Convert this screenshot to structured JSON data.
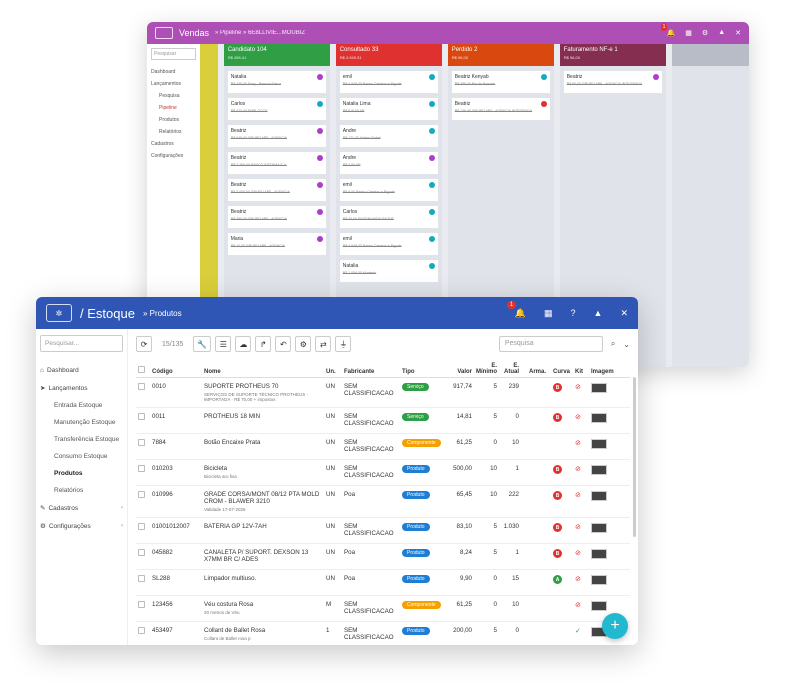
{
  "back": {
    "title": "Vendas",
    "crumb": "» Pipeline » 6E8LLIVIE...MOUBIZ",
    "search_placeholder": "Pesquisar",
    "menu": [
      {
        "label": "Dashboard",
        "cls": ""
      },
      {
        "label": "Lançamentos",
        "cls": ""
      },
      {
        "label": "Pesquisa",
        "cls": "sub"
      },
      {
        "label": "Pipeline",
        "cls": "sub act"
      },
      {
        "label": "Produtos",
        "cls": "sub"
      },
      {
        "label": "Relatórios",
        "cls": "sub"
      },
      {
        "label": "Cadastros",
        "cls": ""
      },
      {
        "label": "Configurações",
        "cls": ""
      }
    ],
    "columns": [
      {
        "name": "Candidato",
        "badge": "104",
        "sub": "R$ 498.41",
        "color": "#2f9e44",
        "cards": [
          {
            "t": "Natalia",
            "d": "R$ 235,00 Sony - Pessoa Física",
            "c": "#ae3ec9"
          },
          {
            "t": "Carlos",
            "d": "R$ 420,00 EMBLOCCS",
            "c": "#15aabf"
          },
          {
            "t": "Beatriz",
            "d": "R$ 549,00 GRUPO APF - AGENCIA",
            "c": "#ae3ec9"
          },
          {
            "t": "Beatriz",
            "d": "R$ 2.360,00 BANCO SISTEMA S.A.",
            "c": "#ae3ec9"
          },
          {
            "t": "Beatriz",
            "d": "R$ 3.000,00 GRUPO APF - AGENCIA",
            "c": "#ae3ec9"
          },
          {
            "t": "Beatriz",
            "d": "R$ 390,00 GRUPO APF - AGENCIA",
            "c": "#ae3ec9"
          },
          {
            "t": "Maria",
            "d": "R$ 10,00 GRUPO APF - AGENCIA",
            "c": "#ae3ec9"
          }
        ]
      },
      {
        "name": "Consultado",
        "badge": "33",
        "sub": "R$ 4.949.31",
        "color": "#e03131",
        "cards": [
          {
            "t": "emil",
            "d": "R$ 4.949,00 Banho Cabelos e Bigode",
            "c": "#15aabf"
          },
          {
            "t": "Natalia Lima",
            "d": "R$ 518,00 AP",
            "c": "#15aabf"
          },
          {
            "t": "Andre",
            "d": "R$ 171,00 Aldeia Global",
            "c": "#15aabf"
          },
          {
            "t": "Andre",
            "d": "R$ 3,00 AP",
            "c": "#ae3ec9"
          },
          {
            "t": "emil",
            "d": "R$ 9,00 Banho Cabelos e Bigode",
            "c": "#15aabf"
          },
          {
            "t": "Carlos",
            "d": "R$ 40,00 ENGENHARIA SAÚDE",
            "c": "#15aabf"
          },
          {
            "t": "emil",
            "d": "R$ 4.949,00 Banho Cabelos e Bigode",
            "c": "#15aabf"
          },
          {
            "t": "Natalia",
            "d": "R$ 1.006,00 Modesto",
            "c": "#15aabf"
          }
        ]
      },
      {
        "name": "Perdido",
        "badge": "2",
        "sub": "R$ 96,00",
        "color": "#d9480f",
        "cards": [
          {
            "t": "Beatriz Kenyab",
            "d": "R$ 386,00 Bia da Horroes",
            "c": "#15aabf"
          },
          {
            "t": "Beatriz",
            "d": "R$ 136,00 GRUPO APF - AGENCIA INTEGRADA",
            "c": "#e03131"
          }
        ]
      },
      {
        "name": "Faturamento NF-e",
        "badge": "1",
        "sub": "R$ 96,00",
        "color": "#862e50",
        "cards": [
          {
            "t": "Beatriz",
            "d": "R$ 80,00 GRUPO APF - AGENCIA INTEGRADA",
            "c": "#ae3ec9"
          }
        ]
      }
    ]
  },
  "front": {
    "title": "Estoque",
    "crumb": "» Produtos",
    "notif_count": "1",
    "search_placeholder": "Pesquisar...",
    "count": "15/135",
    "table_search_placeholder": "Pesquisa",
    "menu": [
      {
        "icon": "⌂",
        "label": "Dashboard",
        "cls": "",
        "chev": ""
      },
      {
        "icon": "➤",
        "label": "Lançamentos",
        "cls": "",
        "chev": ""
      },
      {
        "icon": "",
        "label": "Entrada Estoque",
        "cls": "sub",
        "chev": ""
      },
      {
        "icon": "",
        "label": "Manutenção Estoque",
        "cls": "sub",
        "chev": ""
      },
      {
        "icon": "",
        "label": "Transferência Estoque",
        "cls": "sub",
        "chev": ""
      },
      {
        "icon": "",
        "label": "Consumo Estoque",
        "cls": "sub",
        "chev": ""
      },
      {
        "icon": "",
        "label": "Produtos",
        "cls": "sub bold",
        "chev": ""
      },
      {
        "icon": "",
        "label": "Relatórios",
        "cls": "sub",
        "chev": ""
      },
      {
        "icon": "✎",
        "label": "Cadastros",
        "cls": "",
        "chev": "‹"
      },
      {
        "icon": "⚙",
        "label": "Configurações",
        "cls": "",
        "chev": "‹"
      }
    ],
    "headers": {
      "codigo": "Código",
      "nome": "Nome",
      "un": "Un.",
      "fabricante": "Fabricante",
      "tipo": "Tipo",
      "valor": "Valor",
      "emin": "E. Mínimo",
      "eatual": "E. Atual",
      "arma": "Arma.",
      "curva": "Curva",
      "kit": "Kit",
      "imagem": "Imagem"
    },
    "rows": [
      {
        "codigo": "0010",
        "nome": "SUPORTE PROTHEUS 70",
        "sub": "SERVIÇOS DE SUPORTE TÉCNICO PROTHEUS - IMPORTADA · R$ 70,00 + impostos",
        "un": "UN",
        "fab": "SEM CLASSIFICACAO",
        "tipo": "Serviço",
        "tipo_cls": "servico",
        "valor": "917,74",
        "emin": "5",
        "eatual": "239",
        "curva": "B",
        "curva_color": "#e03131",
        "kit": "⊘",
        "kit_color": "#e03131"
      },
      {
        "codigo": "0011",
        "nome": "PROTHEUS 18 MIN",
        "sub": "",
        "un": "UN",
        "fab": "SEM CLASSIFICACAO",
        "tipo": "Serviço",
        "tipo_cls": "servico",
        "valor": "14,81",
        "emin": "5",
        "eatual": "0",
        "curva": "B",
        "curva_color": "#e03131",
        "kit": "⊘",
        "kit_color": "#e03131"
      },
      {
        "codigo": "7884",
        "nome": "Botão Encaixe Prata",
        "sub": "",
        "un": "UN",
        "fab": "SEM CLASSIFICACAO",
        "tipo": "Componente",
        "tipo_cls": "componente",
        "valor": "61,25",
        "emin": "0",
        "eatual": "10",
        "curva": "",
        "curva_color": "",
        "kit": "⊘",
        "kit_color": "#e03131"
      },
      {
        "codigo": "010203",
        "nome": "Bicicleta",
        "sub": "Bicicleta aro fixa",
        "un": "UN",
        "fab": "SEM CLASSIFICACAO",
        "tipo": "Produto",
        "tipo_cls": "produto",
        "valor": "500,00",
        "emin": "10",
        "eatual": "1",
        "curva": "B",
        "curva_color": "#e03131",
        "kit": "⊘",
        "kit_color": "#e03131"
      },
      {
        "codigo": "010996",
        "nome": "GRADE CORSA/MONT 08/12 PTA MOLD CROM - BLAWER 3210",
        "sub": "Validade 17-07-2026",
        "un": "UN",
        "fab": "Poa",
        "tipo": "Produto",
        "tipo_cls": "produto",
        "valor": "65,45",
        "emin": "10",
        "eatual": "222",
        "curva": "B",
        "curva_color": "#e03131",
        "kit": "⊘",
        "kit_color": "#e03131"
      },
      {
        "codigo": "01001012007",
        "nome": "BATERIA GP 12V-7AH",
        "sub": "",
        "un": "UN",
        "fab": "SEM CLASSIFICACAO",
        "tipo": "Produto",
        "tipo_cls": "produto",
        "valor": "83,10",
        "emin": "5",
        "eatual": "1.030",
        "curva": "B",
        "curva_color": "#e03131",
        "kit": "⊘",
        "kit_color": "#e03131"
      },
      {
        "codigo": "045882",
        "nome": "CANALETA P/ SUPORT. DEXSON 13 X7MM BR C/ ADES",
        "sub": "",
        "un": "UN",
        "fab": "Poa",
        "tipo": "Produto",
        "tipo_cls": "produto",
        "valor": "8,24",
        "emin": "5",
        "eatual": "1",
        "curva": "B",
        "curva_color": "#e03131",
        "kit": "⊘",
        "kit_color": "#e03131"
      },
      {
        "codigo": "SL288",
        "nome": "Limpador multiuso.",
        "sub": "",
        "un": "UN",
        "fab": "Poa",
        "tipo": "Produto",
        "tipo_cls": "produto",
        "valor": "9,90",
        "emin": "0",
        "eatual": "15",
        "curva": "A",
        "curva_color": "#2f9e44",
        "kit": "⊘",
        "kit_color": "#e03131"
      },
      {
        "codigo": "123456",
        "nome": "Véu costura Rosa",
        "sub": "20 metros de Véu",
        "un": "M",
        "fab": "SEM CLASSIFICACAO",
        "tipo": "Componente",
        "tipo_cls": "componente",
        "valor": "61,25",
        "emin": "0",
        "eatual": "10",
        "curva": "",
        "curva_color": "",
        "kit": "⊘",
        "kit_color": "#e03131"
      },
      {
        "codigo": "453497",
        "nome": "Collant de Ballet Rosa",
        "sub": "Collant de Ballet rosa p",
        "un": "1",
        "fab": "SEM CLASSIFICACAO",
        "tipo": "Produto",
        "tipo_cls": "produto",
        "valor": "200,00",
        "emin": "5",
        "eatual": "0",
        "curva": "",
        "curva_color": "",
        "kit": "✓",
        "kit_color": "#2f9e44"
      }
    ]
  }
}
